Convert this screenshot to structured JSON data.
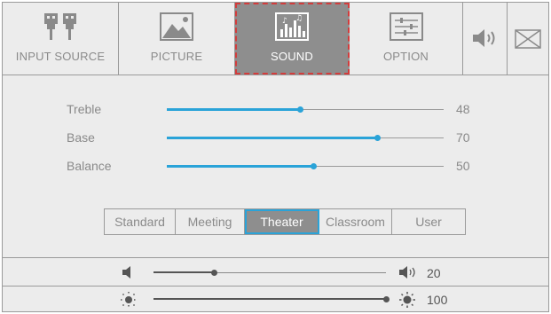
{
  "tabs": [
    {
      "label": "INPUT SOURCE",
      "icon": "input-source-icon",
      "active": false
    },
    {
      "label": "PICTURE",
      "icon": "picture-icon",
      "active": false
    },
    {
      "label": "SOUND",
      "icon": "sound-equalizer-icon",
      "active": true
    },
    {
      "label": "OPTION",
      "icon": "option-sliders-icon",
      "active": false
    }
  ],
  "extra_tabs": [
    {
      "icon": "speaker-icon"
    },
    {
      "icon": "mail-icon"
    }
  ],
  "sound": {
    "sliders": [
      {
        "label": "Treble",
        "value": "48",
        "fraction": 0.48
      },
      {
        "label": "Base",
        "value": "70",
        "fraction": 0.76
      },
      {
        "label": "Balance",
        "value": "50",
        "fraction": 0.53
      }
    ],
    "modes": [
      {
        "label": "Standard",
        "active": false
      },
      {
        "label": "Meeting",
        "active": false
      },
      {
        "label": "Theater",
        "active": true
      },
      {
        "label": "Classroom",
        "active": false
      },
      {
        "label": "User",
        "active": false
      }
    ]
  },
  "volume": {
    "value": "20",
    "fraction": 0.26,
    "icon_left": "speaker-mute-icon",
    "icon_right": "speaker-volume-icon"
  },
  "brightness": {
    "value": "100",
    "fraction": 1.0,
    "icon_left": "brightness-low-icon",
    "icon_right": "brightness-high-icon"
  },
  "colors": {
    "accent": "#2aa3d8",
    "active_tab": "#8e8e8e",
    "active_outline": "#d23c3c",
    "background": "#ececec"
  }
}
